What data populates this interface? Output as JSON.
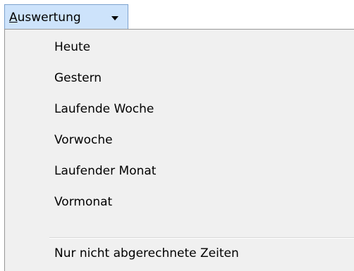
{
  "menubar": {
    "button_mnemonic": "A",
    "button_rest": "uswertung"
  },
  "dropdown": {
    "items": [
      {
        "label": "Heute"
      },
      {
        "label": "Gestern"
      },
      {
        "label": "Laufende Woche"
      },
      {
        "label": "Vorwoche"
      },
      {
        "label": "Laufender Monat"
      },
      {
        "label": "Vormonat"
      }
    ],
    "footer_item": {
      "label": "Nur nicht abgerechnete Zeiten"
    }
  }
}
